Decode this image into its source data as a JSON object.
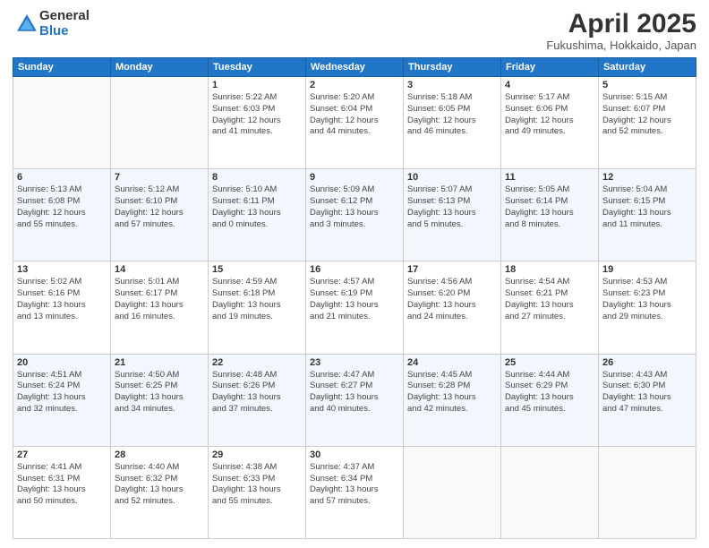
{
  "logo": {
    "general": "General",
    "blue": "Blue"
  },
  "title": "April 2025",
  "location": "Fukushima, Hokkaido, Japan",
  "weekdays": [
    "Sunday",
    "Monday",
    "Tuesday",
    "Wednesday",
    "Thursday",
    "Friday",
    "Saturday"
  ],
  "weeks": [
    [
      {
        "day": "",
        "info": ""
      },
      {
        "day": "",
        "info": ""
      },
      {
        "day": "1",
        "info": "Sunrise: 5:22 AM\nSunset: 6:03 PM\nDaylight: 12 hours\nand 41 minutes."
      },
      {
        "day": "2",
        "info": "Sunrise: 5:20 AM\nSunset: 6:04 PM\nDaylight: 12 hours\nand 44 minutes."
      },
      {
        "day": "3",
        "info": "Sunrise: 5:18 AM\nSunset: 6:05 PM\nDaylight: 12 hours\nand 46 minutes."
      },
      {
        "day": "4",
        "info": "Sunrise: 5:17 AM\nSunset: 6:06 PM\nDaylight: 12 hours\nand 49 minutes."
      },
      {
        "day": "5",
        "info": "Sunrise: 5:15 AM\nSunset: 6:07 PM\nDaylight: 12 hours\nand 52 minutes."
      }
    ],
    [
      {
        "day": "6",
        "info": "Sunrise: 5:13 AM\nSunset: 6:08 PM\nDaylight: 12 hours\nand 55 minutes."
      },
      {
        "day": "7",
        "info": "Sunrise: 5:12 AM\nSunset: 6:10 PM\nDaylight: 12 hours\nand 57 minutes."
      },
      {
        "day": "8",
        "info": "Sunrise: 5:10 AM\nSunset: 6:11 PM\nDaylight: 13 hours\nand 0 minutes."
      },
      {
        "day": "9",
        "info": "Sunrise: 5:09 AM\nSunset: 6:12 PM\nDaylight: 13 hours\nand 3 minutes."
      },
      {
        "day": "10",
        "info": "Sunrise: 5:07 AM\nSunset: 6:13 PM\nDaylight: 13 hours\nand 5 minutes."
      },
      {
        "day": "11",
        "info": "Sunrise: 5:05 AM\nSunset: 6:14 PM\nDaylight: 13 hours\nand 8 minutes."
      },
      {
        "day": "12",
        "info": "Sunrise: 5:04 AM\nSunset: 6:15 PM\nDaylight: 13 hours\nand 11 minutes."
      }
    ],
    [
      {
        "day": "13",
        "info": "Sunrise: 5:02 AM\nSunset: 6:16 PM\nDaylight: 13 hours\nand 13 minutes."
      },
      {
        "day": "14",
        "info": "Sunrise: 5:01 AM\nSunset: 6:17 PM\nDaylight: 13 hours\nand 16 minutes."
      },
      {
        "day": "15",
        "info": "Sunrise: 4:59 AM\nSunset: 6:18 PM\nDaylight: 13 hours\nand 19 minutes."
      },
      {
        "day": "16",
        "info": "Sunrise: 4:57 AM\nSunset: 6:19 PM\nDaylight: 13 hours\nand 21 minutes."
      },
      {
        "day": "17",
        "info": "Sunrise: 4:56 AM\nSunset: 6:20 PM\nDaylight: 13 hours\nand 24 minutes."
      },
      {
        "day": "18",
        "info": "Sunrise: 4:54 AM\nSunset: 6:21 PM\nDaylight: 13 hours\nand 27 minutes."
      },
      {
        "day": "19",
        "info": "Sunrise: 4:53 AM\nSunset: 6:23 PM\nDaylight: 13 hours\nand 29 minutes."
      }
    ],
    [
      {
        "day": "20",
        "info": "Sunrise: 4:51 AM\nSunset: 6:24 PM\nDaylight: 13 hours\nand 32 minutes."
      },
      {
        "day": "21",
        "info": "Sunrise: 4:50 AM\nSunset: 6:25 PM\nDaylight: 13 hours\nand 34 minutes."
      },
      {
        "day": "22",
        "info": "Sunrise: 4:48 AM\nSunset: 6:26 PM\nDaylight: 13 hours\nand 37 minutes."
      },
      {
        "day": "23",
        "info": "Sunrise: 4:47 AM\nSunset: 6:27 PM\nDaylight: 13 hours\nand 40 minutes."
      },
      {
        "day": "24",
        "info": "Sunrise: 4:45 AM\nSunset: 6:28 PM\nDaylight: 13 hours\nand 42 minutes."
      },
      {
        "day": "25",
        "info": "Sunrise: 4:44 AM\nSunset: 6:29 PM\nDaylight: 13 hours\nand 45 minutes."
      },
      {
        "day": "26",
        "info": "Sunrise: 4:43 AM\nSunset: 6:30 PM\nDaylight: 13 hours\nand 47 minutes."
      }
    ],
    [
      {
        "day": "27",
        "info": "Sunrise: 4:41 AM\nSunset: 6:31 PM\nDaylight: 13 hours\nand 50 minutes."
      },
      {
        "day": "28",
        "info": "Sunrise: 4:40 AM\nSunset: 6:32 PM\nDaylight: 13 hours\nand 52 minutes."
      },
      {
        "day": "29",
        "info": "Sunrise: 4:38 AM\nSunset: 6:33 PM\nDaylight: 13 hours\nand 55 minutes."
      },
      {
        "day": "30",
        "info": "Sunrise: 4:37 AM\nSunset: 6:34 PM\nDaylight: 13 hours\nand 57 minutes."
      },
      {
        "day": "",
        "info": ""
      },
      {
        "day": "",
        "info": ""
      },
      {
        "day": "",
        "info": ""
      }
    ]
  ]
}
